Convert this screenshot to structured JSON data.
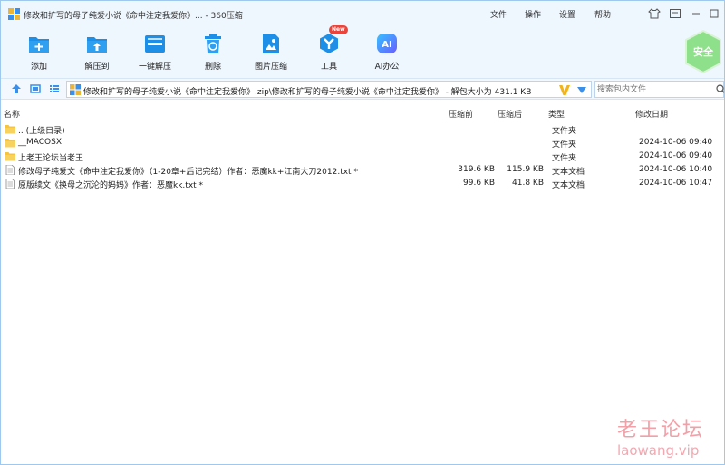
{
  "window": {
    "title": "修改和扩写的母子纯爱小说《命中注定我爱你》... - 360压缩"
  },
  "menu": {
    "items": [
      "文件",
      "操作",
      "设置",
      "帮助"
    ]
  },
  "toolbar": {
    "items": [
      {
        "label": "添加",
        "icon": "add-icon"
      },
      {
        "label": "解压到",
        "icon": "extract-to-icon"
      },
      {
        "label": "一键解压",
        "icon": "one-click-extract-icon"
      },
      {
        "label": "删除",
        "icon": "trash-icon"
      },
      {
        "label": "图片压缩",
        "icon": "image-compress-icon"
      },
      {
        "label": "工具",
        "icon": "tools-icon"
      },
      {
        "label": "AI办公",
        "icon": "ai-office-icon"
      }
    ],
    "new_badge": "New",
    "security_label": "安全"
  },
  "address": {
    "path": "修改和扩写的母子纯爱小说《命中注定我爱你》.zip\\修改和扩写的母子纯爱小说《命中注定我爱你》 - 解包大小为 431.1 KB"
  },
  "search": {
    "placeholder": "搜索包内文件"
  },
  "columns": {
    "name": "名称",
    "before": "压缩前",
    "after": "压缩后",
    "type": "类型",
    "date": "修改日期"
  },
  "files": [
    {
      "name": ".. (上级目录)",
      "before": "",
      "after": "",
      "type": "文件夹",
      "date": "",
      "kind": "folder"
    },
    {
      "name": "__MACOSX",
      "before": "",
      "after": "",
      "type": "文件夹",
      "date": "2024-10-06 09:40",
      "kind": "folder"
    },
    {
      "name": "上老王论坛当老王",
      "before": "",
      "after": "",
      "type": "文件夹",
      "date": "2024-10-06 09:40",
      "kind": "folder"
    },
    {
      "name": "修改母子纯爱文《命中注定我爱你》（1-20章+后记完结）作者：恶魔kk+江南大刀2012.txt *",
      "before": "319.6 KB",
      "after": "115.9 KB",
      "type": "文本文档",
      "date": "2024-10-06 10:40",
      "kind": "text"
    },
    {
      "name": "原版续文《换母之沉沦的妈妈》作者：恶魔kk.txt *",
      "before": "99.6 KB",
      "after": "41.8 KB",
      "type": "文本文档",
      "date": "2024-10-06 10:47",
      "kind": "text"
    }
  ],
  "watermark": {
    "title": "老王论坛",
    "url": "laowang.vip"
  },
  "colors": {
    "accent": "#1e8fe6",
    "toolbar_bg": "#eef6fe",
    "folder": "#f5c542",
    "security": "#7dd87a",
    "new_badge": "#e8453c"
  }
}
